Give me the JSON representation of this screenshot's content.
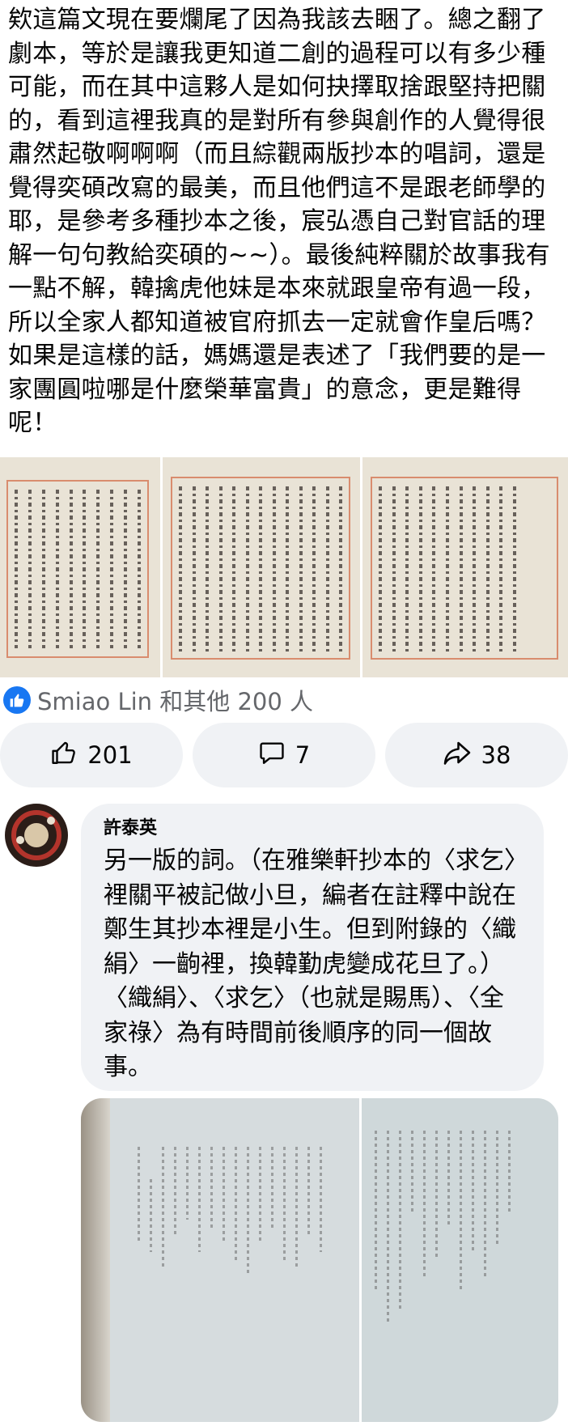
{
  "post": {
    "text": "欸這篇文現在要爛尾了因為我該去睏了。總之翻了劇本，等於是讓我更知道二創的過程可以有多少種可能，而在其中這夥人是如何抉擇取捨跟堅持把關的，看到這裡我真的是對所有參與創作的人覺得很肅然起敬啊啊啊（而且綜觀兩版抄本的唱詞，還是覺得奕碩改寫的最美，而且他們這不是跟老師學的耶，是參考多種抄本之後，宸弘憑自己對官話的理解一句句教給奕碩的~~）。最後純粹關於故事我有一點不解，韓擒虎他妹是本來就跟皇帝有過一段，所以全家人都知道被官府抓去一定就會作皇后嗎？如果是這樣的話，媽媽還是表述了「我們要的是一家團圓啦哪是什麼榮華富貴」的意念，更是難得呢！"
  },
  "reactions": {
    "summary": "Smiao Lin 和其他 200 人",
    "icon": "like-icon",
    "color": "#1877f2"
  },
  "actions": {
    "like_count": "201",
    "comment_count": "7",
    "share_count": "38"
  },
  "comment": {
    "author": "許泰英",
    "text": "另一版的詞。（在雅樂軒抄本的〈求乞〉裡關平被記做小旦，編者在註釋中說在鄭生其抄本裡是小生。但到附錄的〈織絹〉一齣裡，換韓勤虎變成花旦了。）〈織絹〉、〈求乞〉（也就是賜馬）、〈全家祿〉為有時間前後順序的同一個故事。"
  }
}
